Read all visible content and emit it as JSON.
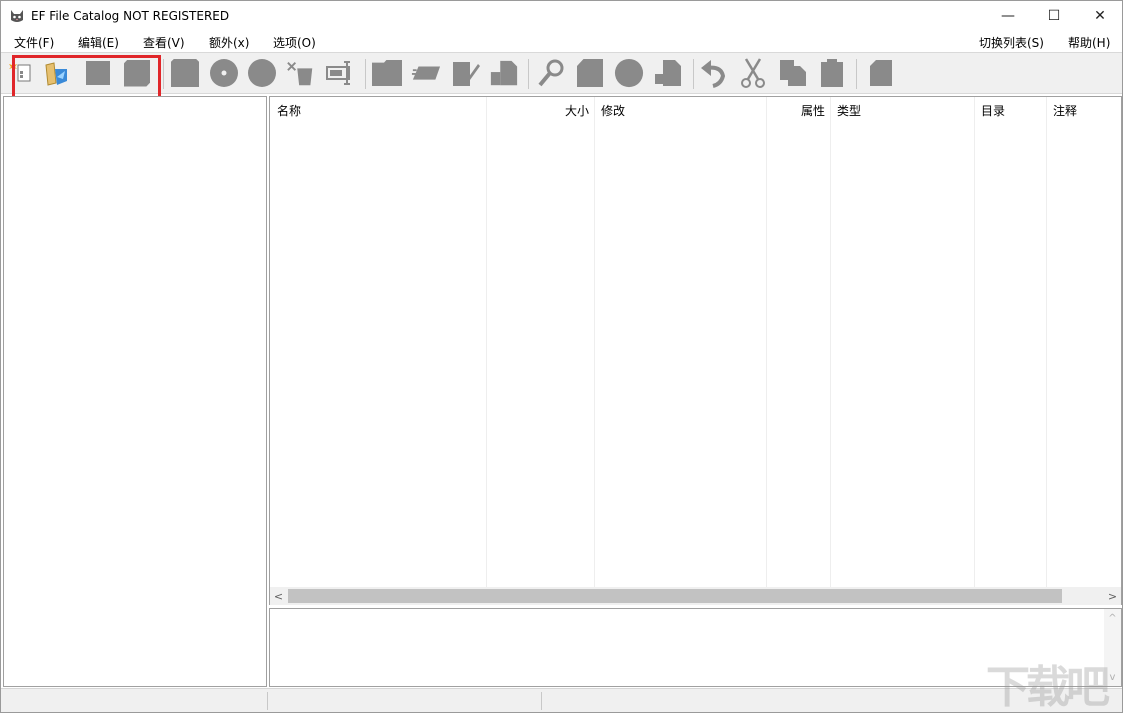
{
  "window": {
    "title": "EF File Catalog NOT REGISTERED",
    "controls": {
      "minimize": "—",
      "maximize": "☐",
      "close": "✕"
    }
  },
  "menu": {
    "items": [
      {
        "label": "文件(F)"
      },
      {
        "label": "编辑(E)"
      },
      {
        "label": "查看(V)"
      },
      {
        "label": "额外(x)"
      },
      {
        "label": "选项(O)"
      }
    ],
    "right_items": [
      {
        "label": "切换列表(S)"
      },
      {
        "label": "帮助(H)"
      }
    ]
  },
  "toolbar": {
    "buttons": [
      {
        "icon": "new-catalog-icon"
      },
      {
        "icon": "open-catalog-icon"
      },
      {
        "icon": "save-icon"
      },
      {
        "icon": "save-all-icon"
      },
      {
        "icon": "add-disk-icon"
      },
      {
        "icon": "cd-icon"
      },
      {
        "icon": "disk-icon"
      },
      {
        "icon": "delete-icon"
      },
      {
        "icon": "rename-icon"
      },
      {
        "icon": "folder-icon"
      },
      {
        "icon": "folder-open-icon"
      },
      {
        "icon": "edit-icon"
      },
      {
        "icon": "properties-icon"
      },
      {
        "icon": "search-icon"
      },
      {
        "icon": "document-icon"
      },
      {
        "icon": "circle-icon"
      },
      {
        "icon": "export-icon"
      },
      {
        "icon": "undo-icon"
      },
      {
        "icon": "cut-icon"
      },
      {
        "icon": "copy-icon"
      },
      {
        "icon": "paste-icon"
      },
      {
        "icon": "info-icon"
      }
    ],
    "highlight_color": "#e0262a"
  },
  "list": {
    "columns": [
      {
        "label": "名称"
      },
      {
        "label": "大小"
      },
      {
        "label": "修改"
      },
      {
        "label": "属性"
      },
      {
        "label": "类型"
      },
      {
        "label": "目录"
      },
      {
        "label": "注释"
      }
    ],
    "rows": []
  },
  "scrollbar": {
    "left_arrow": "<",
    "right_arrow": ">",
    "up_arrow": "^",
    "down_arrow": "v"
  },
  "watermark": {
    "text": "下载吧"
  }
}
